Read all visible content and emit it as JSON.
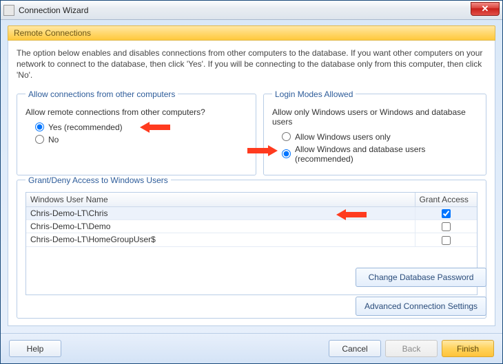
{
  "titlebar": {
    "title": "Connection Wizard",
    "close_glyph": "✕"
  },
  "section_header": "Remote Connections",
  "intro": "The option below enables and disables connections from other computers to the database. If you want other computers on your network to connect to the database, then click 'Yes'. If you will be connecting to the database only from this computer, then click 'No'.",
  "allow_group": {
    "legend": "Allow connections from other computers",
    "question": "Allow remote connections from other computers?",
    "yes_label": "Yes (recommended)",
    "no_label": "No",
    "selected": "yes"
  },
  "login_group": {
    "legend": "Login Modes Allowed",
    "question": "Allow only Windows users or Windows and database users",
    "opt_windows_only": "Allow Windows users only",
    "opt_windows_and_db": "Allow Windows and database users (recommended)",
    "selected": "windows_and_db"
  },
  "grant_group": {
    "legend": "Grant/Deny Access to Windows Users",
    "col_user": "Windows User Name",
    "col_grant": "Grant Access",
    "rows": [
      {
        "user": "Chris-Demo-LT\\Chris",
        "granted": true,
        "selected": true
      },
      {
        "user": "Chris-Demo-LT\\Demo",
        "granted": false,
        "selected": false
      },
      {
        "user": "Chris-Demo-LT\\HomeGroupUser$",
        "granted": false,
        "selected": false
      }
    ]
  },
  "right_buttons": {
    "change_pw": "Change Database Password",
    "advanced": "Advanced Connection Settings"
  },
  "footer": {
    "help": "Help",
    "cancel": "Cancel",
    "back": "Back",
    "finish": "Finish"
  }
}
